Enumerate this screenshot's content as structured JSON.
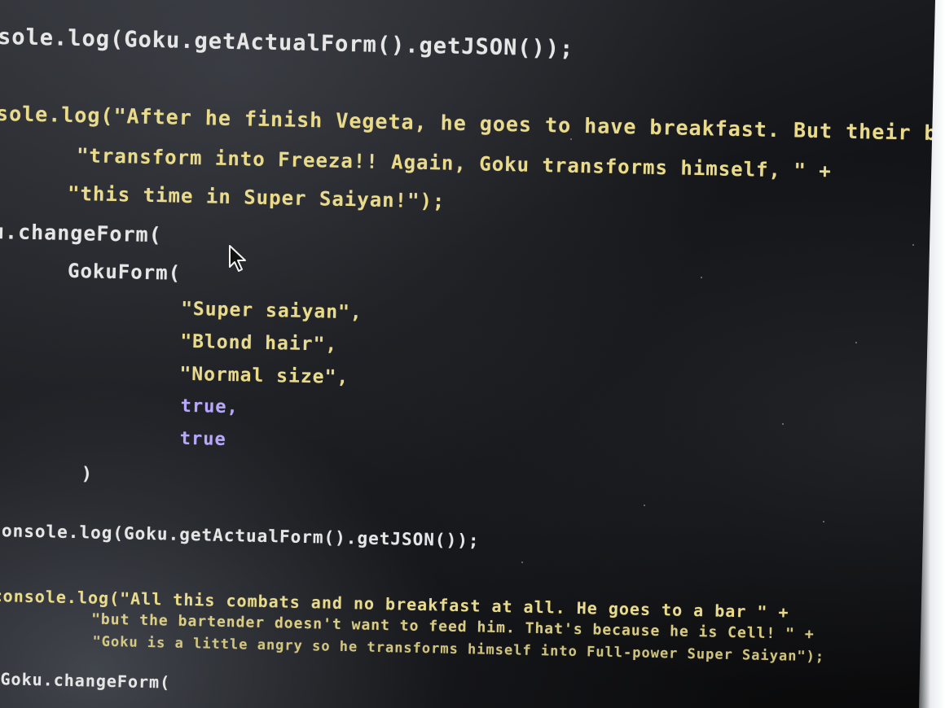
{
  "lines": {
    "l1": "sole.log(Goku.getActualForm().getJSON());",
    "l2": "sole.log(\"After he finish Vegeta, he goes to have breakfast. But their beans \" +",
    "l3": "\"transform into Freeza!! Again, Goku transforms himself, \" +",
    "l4": "\"this time in Super Saiyan!\");",
    "l5": "u.changeForm(",
    "l6": "GokuForm(",
    "l7": "\"Super saiyan\",",
    "l8": "\"Blond hair\",",
    "l9": "\"Normal size\",",
    "l10": "true,",
    "l11": "true",
    "l12": ")",
    "l13": ";",
    "l14": "console.log(Goku.getActualForm().getJSON());",
    "l15": "console.log(\"All this combats and no breakfast at all. He goes to a bar \" +",
    "l16": "\"but the bartender doesn't want to feed him. That's because he is Cell! \" +",
    "l17": "\"Goku is a little angry so he transforms himself into Full-power Super Saiyan\");",
    "l18": "Goku.changeForm("
  },
  "colors": {
    "background": "#0b0b0c",
    "plain_text": "#e6e6e6",
    "string_text": "#eadb8a",
    "keyword_text": "#b9a6ff"
  },
  "icons": {
    "cursor": "mouse-pointer-icon"
  }
}
